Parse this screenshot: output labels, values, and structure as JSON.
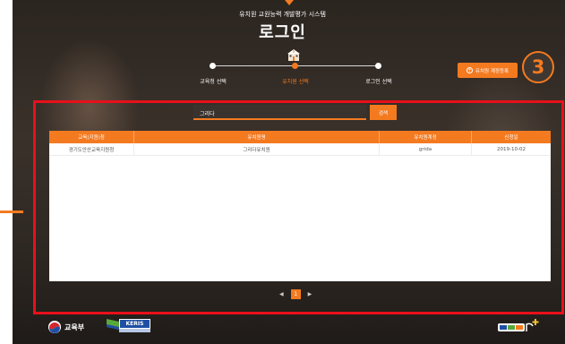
{
  "header": {
    "system_name": "유치원 교원능력 개발평가 시스템",
    "title": "로그인"
  },
  "steps": [
    {
      "label": "교육청 선택",
      "state": "done"
    },
    {
      "label": "유치원 선택",
      "state": "active"
    },
    {
      "label": "로그인 선택",
      "state": "pending"
    }
  ],
  "register_button": {
    "label": "유치원 계정등록",
    "icon": "plus-circle-icon"
  },
  "annotation_badge": "3",
  "search": {
    "value": "그리다",
    "button_label": "검색"
  },
  "table": {
    "columns": [
      "교육(지원)청",
      "유치원명",
      "유치원계정",
      "신청일"
    ],
    "rows": [
      [
        "경기도안산교육지원청",
        "그리다유치원",
        "grida",
        "2019-10-02"
      ]
    ]
  },
  "pagination": {
    "prev": "◀",
    "current": "1",
    "next": "▶"
  },
  "footer": {
    "ministry_name": "교육부",
    "keris_label": "KERIS"
  },
  "colors": {
    "accent": "#f47a20",
    "annotation_red": "#e8101a"
  }
}
